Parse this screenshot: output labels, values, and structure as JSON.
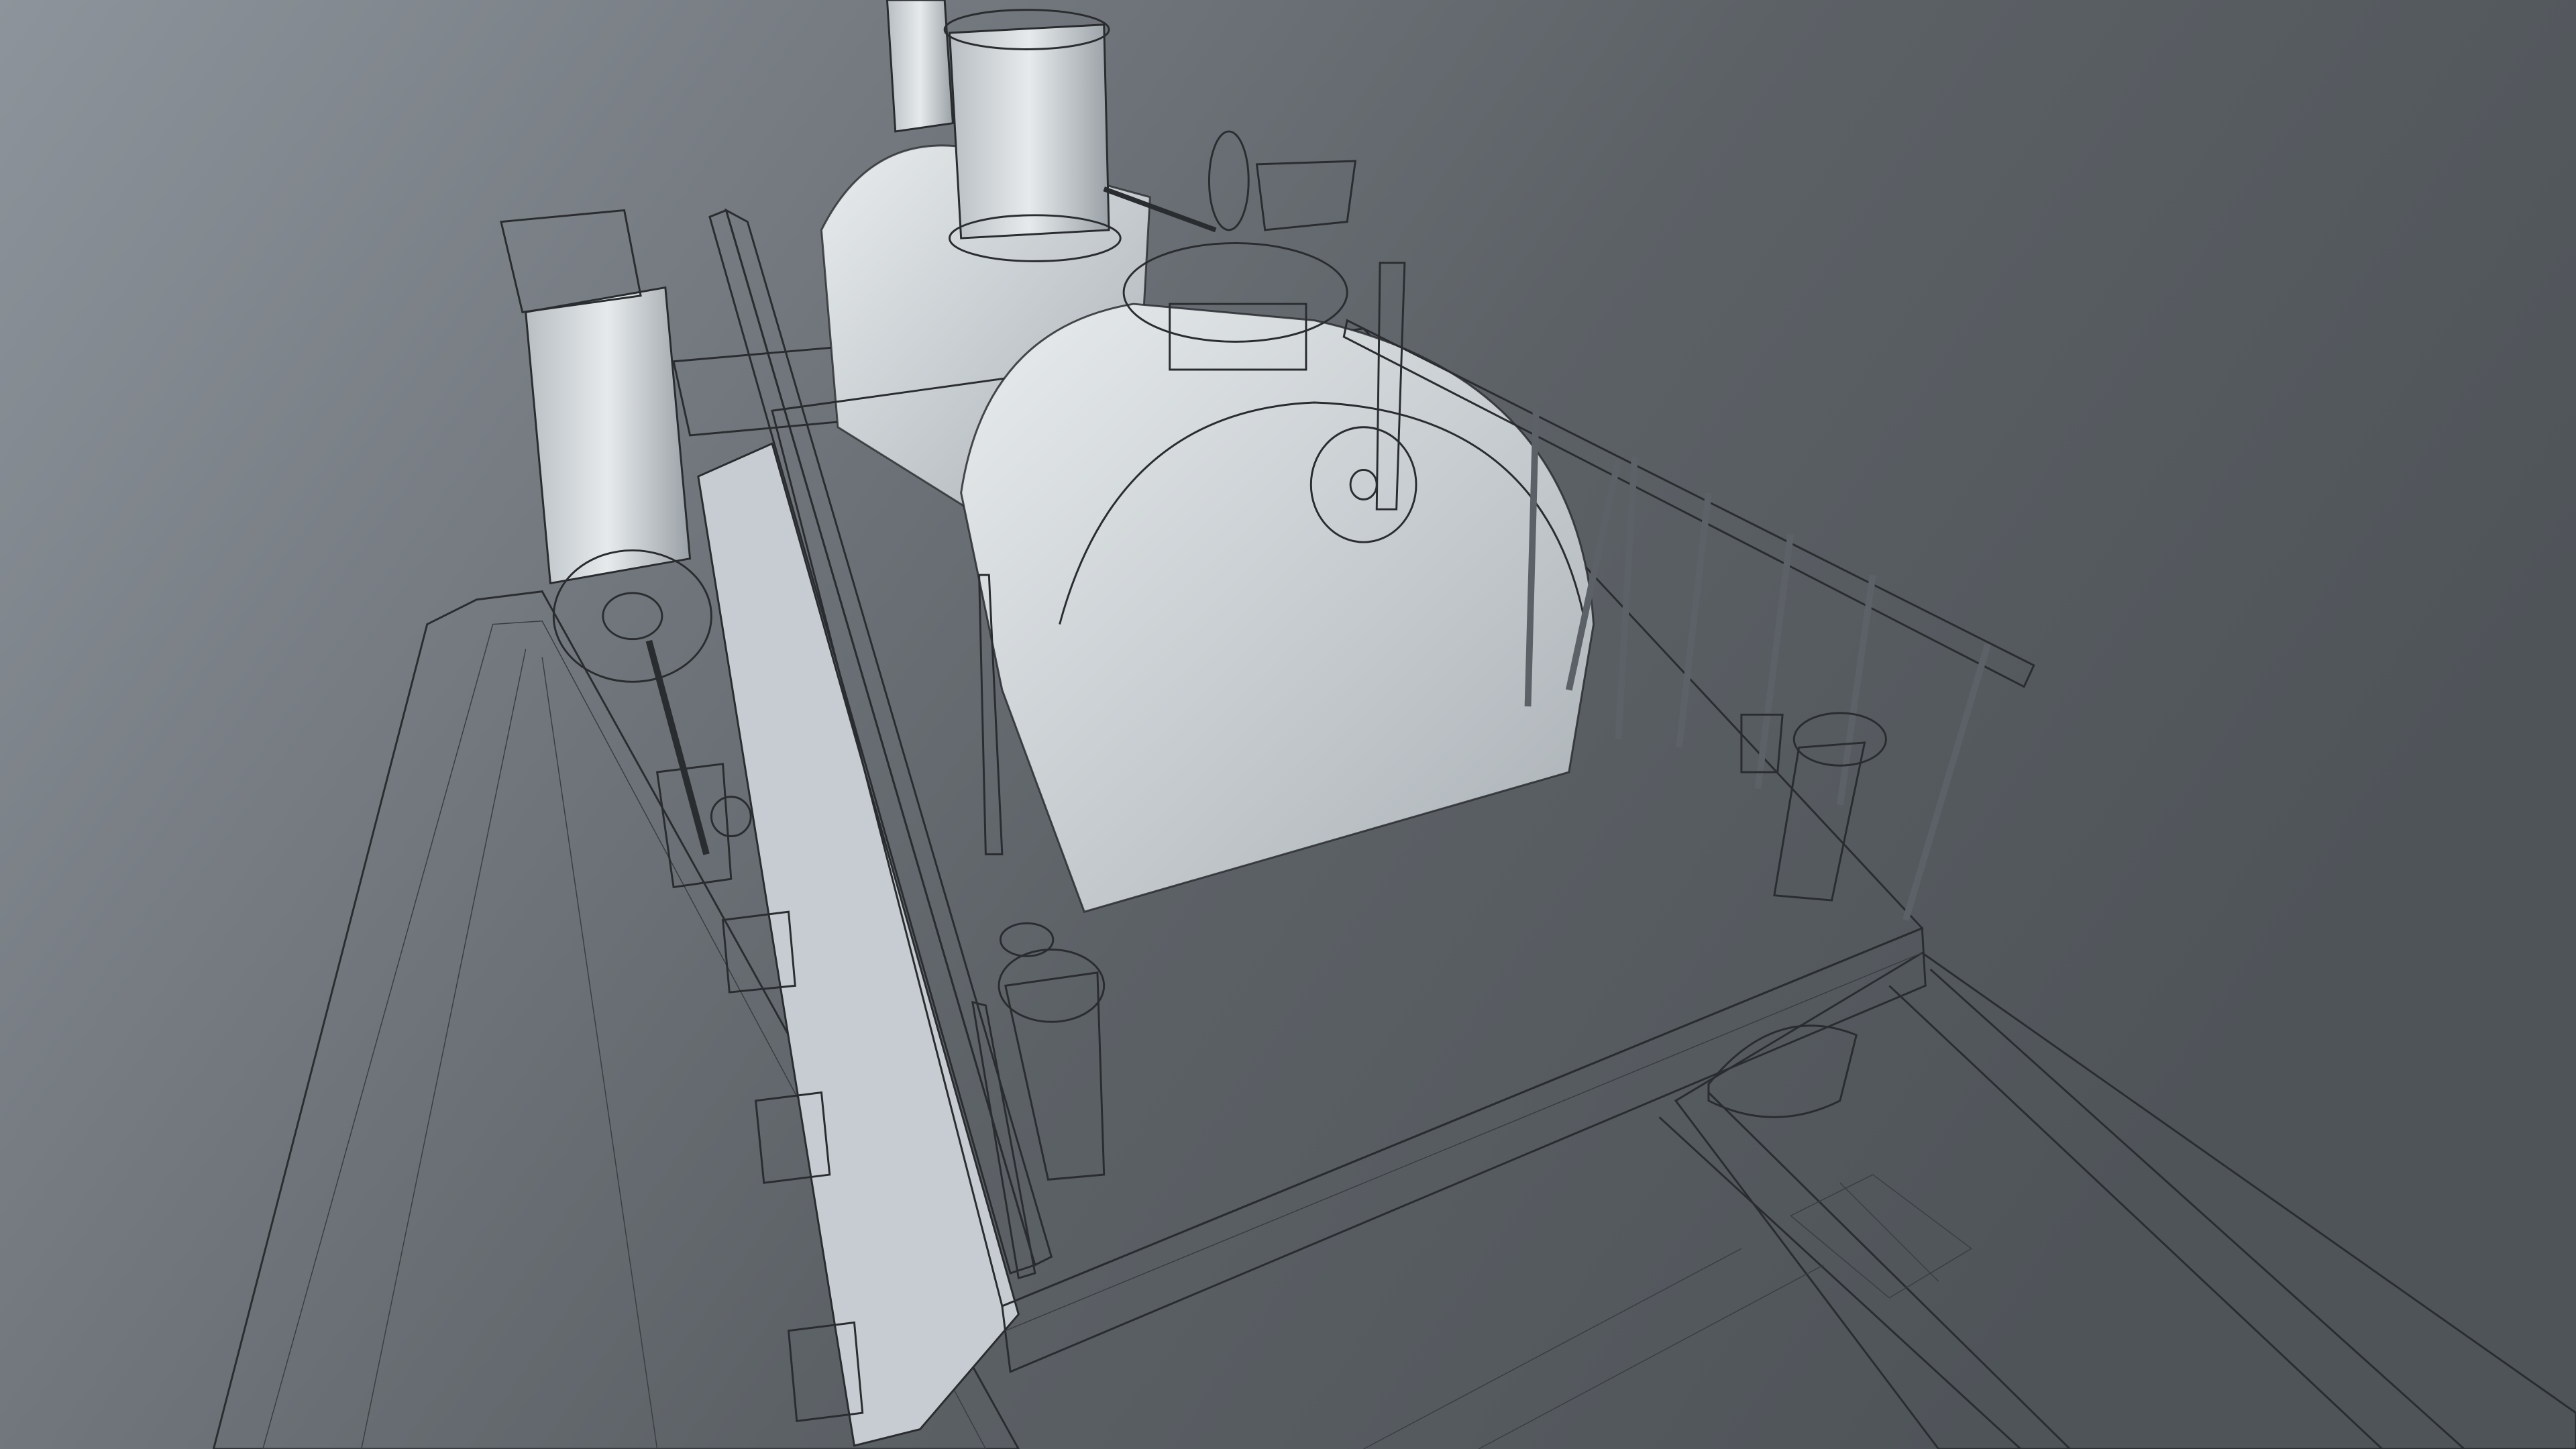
{
  "scene": {
    "subject": "steam-locomotive-wireframe",
    "colors": {
      "background_light": "#8d949b",
      "background_dark": "#4f5459",
      "surface_light": "#e6eaec",
      "surface_mid": "#b9bfc4",
      "surface_dark": "#8a9096",
      "wire": "#2a2d30"
    }
  }
}
